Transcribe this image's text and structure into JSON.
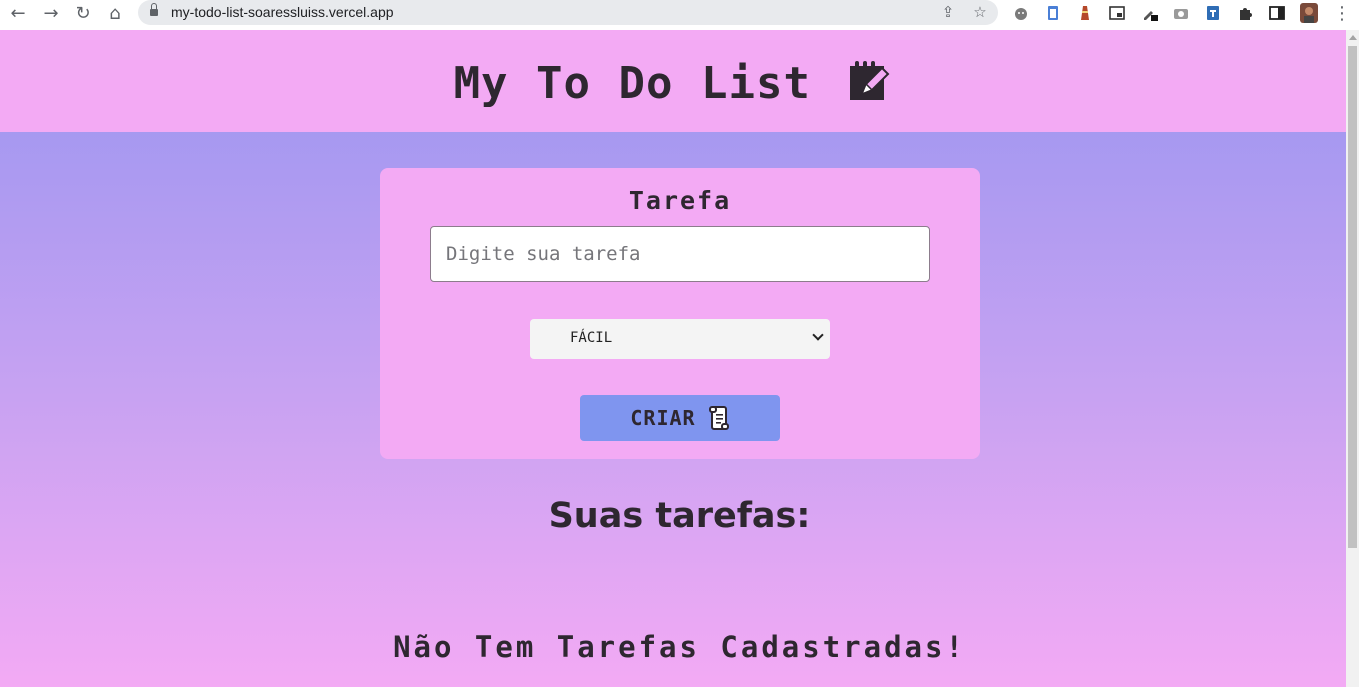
{
  "browser": {
    "url": "my-todo-list-soaressluiss.vercel.app",
    "nav": {
      "back": "←",
      "forward": "→",
      "reload": "↻",
      "home": "⌂"
    },
    "omnibox_icons": {
      "share": "⇪",
      "bookmark": "☆"
    },
    "menu": "⋮"
  },
  "header": {
    "title": "My To Do List"
  },
  "form": {
    "label": "Tarefa",
    "input_placeholder": "Digite sua tarefa",
    "input_value": "",
    "difficulty_selected": "FÁCIL",
    "create_label": "CRIAR"
  },
  "tasks": {
    "heading": "Suas tarefas:",
    "empty_message": "Não Tem Tarefas Cadastradas!"
  },
  "colors": {
    "header_bg": "#f3aaf4",
    "card_bg": "#f3aaf4",
    "button_bg": "#7f95ef",
    "text": "#2e2730"
  },
  "icons": {
    "title_icon": "memo-icon",
    "button_icon": "scroll-icon"
  }
}
